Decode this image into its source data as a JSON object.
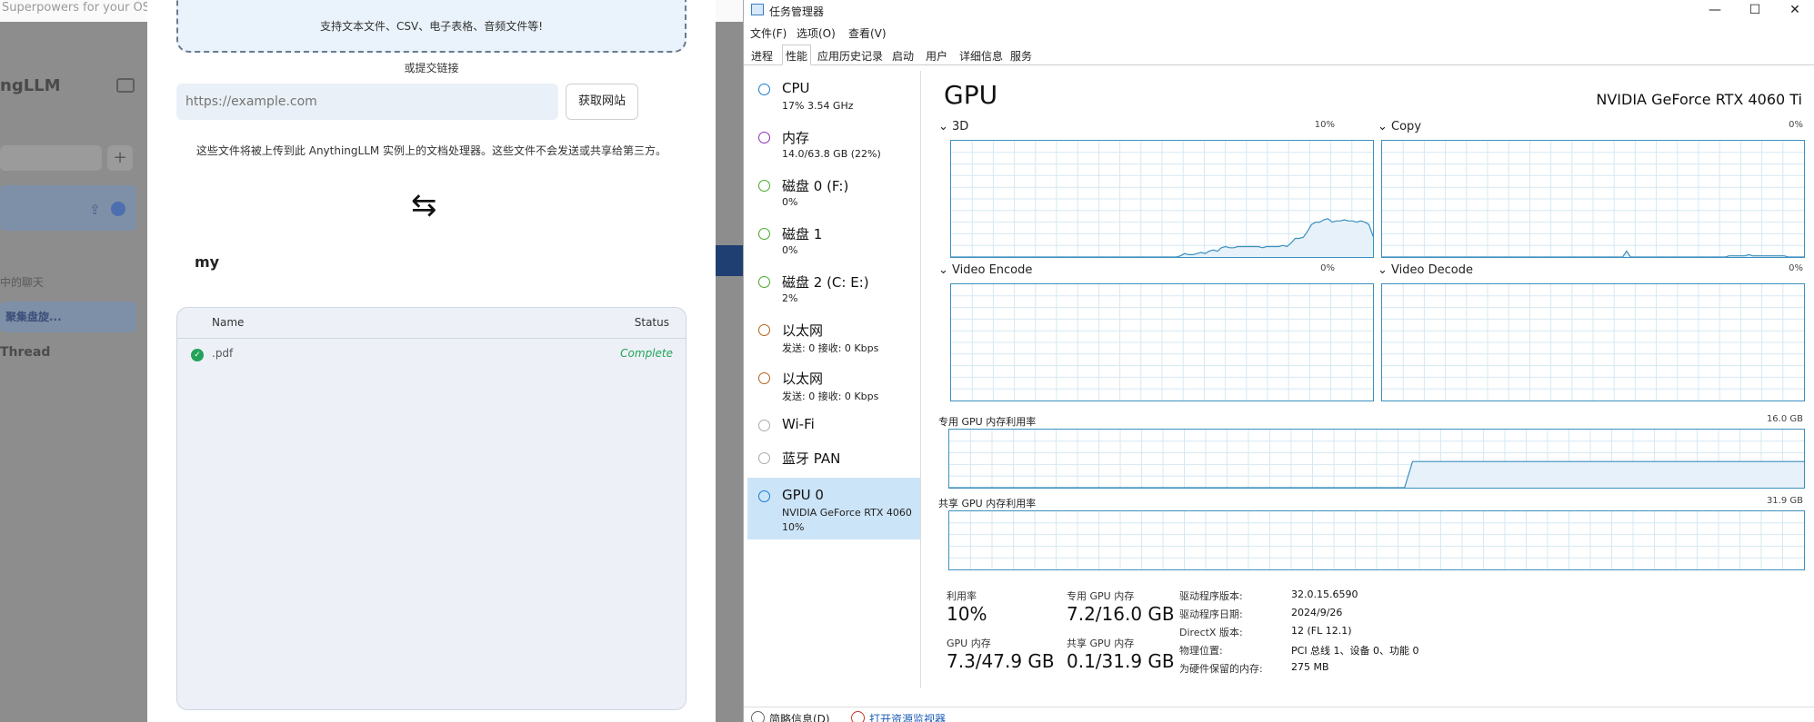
{
  "llm": {
    "tagline": "Superpowers for your OS using local AI",
    "brand": "ngLLM",
    "sidebar_item1": "中的聊天",
    "sidebar_item2": "聚集盘旋...",
    "sidebar_item3": "Thread",
    "modal": {
      "dropzone_text": "支持文本文件、CSV、电子表格、音频文件等!",
      "or_link": "或提交链接",
      "url_placeholder": "https://example.com",
      "fetch_button": "获取网站",
      "notice": "这些文件将被上传到此 AnythingLLM 实例上的文档处理器。这些文件不会发送或共享给第三方。",
      "swap_icon": "⇆",
      "workspace_name": "my",
      "table": {
        "col_name": "Name",
        "col_status": "Status",
        "rows": [
          {
            "name": ".pdf",
            "status": "Complete"
          }
        ]
      }
    }
  },
  "tm": {
    "title": "任务管理器",
    "window_buttons": {
      "minimize": "—",
      "maximize": "☐",
      "close": "✕"
    },
    "menu": [
      "文件(F)",
      "选项(O)",
      "查看(V)"
    ],
    "tabs": [
      "进程",
      "性能",
      "应用历史记录",
      "启动",
      "用户",
      "详细信息",
      "服务"
    ],
    "active_tab": "性能",
    "sidebar": [
      {
        "name": "CPU",
        "sub": "17% 3.54 GHz",
        "sub2": "",
        "color": "#1a7bd3"
      },
      {
        "name": "内存",
        "sub": "14.0/63.8 GB (22%)",
        "sub2": "",
        "color": "#8b2fb8"
      },
      {
        "name": "磁盘 0 (F:)",
        "sub": "0%",
        "sub2": "",
        "color": "#4aa829"
      },
      {
        "name": "磁盘 1",
        "sub": "0%",
        "sub2": "",
        "color": "#4aa829"
      },
      {
        "name": "磁盘 2 (C: E:)",
        "sub": "2%",
        "sub2": "",
        "color": "#4aa829"
      },
      {
        "name": "以太网",
        "sub": "发送: 0 接收: 0 Kbps",
        "sub2": "",
        "color": "#b3621a"
      },
      {
        "name": "以太网",
        "sub": "发送: 0 接收: 0 Kbps",
        "sub2": "",
        "color": "#b3621a"
      },
      {
        "name": "Wi-Fi",
        "sub": "",
        "sub2": "",
        "color": "#aaaaaa"
      },
      {
        "name": "蓝牙 PAN",
        "sub": "",
        "sub2": "",
        "color": "#aaaaaa"
      },
      {
        "name": "GPU 0",
        "sub": "NVIDIA GeForce RTX 4060",
        "sub2": "10%",
        "color": "#1a7bd3"
      }
    ],
    "gpu": {
      "title": "GPU",
      "model": "NVIDIA GeForce RTX 4060 Ti",
      "graphs": {
        "g3d": {
          "label": "3D",
          "pct": "10%"
        },
        "copy": {
          "label": "Copy",
          "pct": "0%"
        },
        "encode": {
          "label": "Video Encode",
          "pct": "0%"
        },
        "decode": {
          "label": "Video Decode",
          "pct": "0%"
        },
        "dedicated": {
          "label": "专用 GPU 内存利用率",
          "max": "16.0 GB"
        },
        "shared": {
          "label": "共享 GPU 内存利用率",
          "max": "31.9 GB"
        }
      },
      "series_3d": [
        0,
        0,
        0,
        0,
        0,
        0,
        0,
        0,
        0,
        0,
        0,
        0,
        0,
        0,
        0,
        0,
        0,
        0,
        0,
        0,
        0,
        0,
        0,
        0,
        0,
        0,
        0,
        0,
        0,
        0,
        0,
        0,
        0,
        0,
        0,
        0,
        0,
        0,
        0,
        0,
        0,
        0,
        0,
        0,
        0,
        0,
        0,
        0,
        0,
        0,
        0,
        0,
        0,
        0,
        0,
        0,
        1,
        3,
        2,
        2,
        3,
        4,
        3,
        5,
        6,
        5,
        8,
        9,
        8,
        8,
        9,
        9,
        9,
        9,
        9,
        9,
        8,
        9,
        9,
        9,
        9,
        10,
        9,
        12,
        16,
        16,
        17,
        22,
        28,
        30,
        30,
        32,
        33,
        30,
        31,
        31,
        32,
        31,
        31,
        30,
        31,
        30,
        28,
        18
      ],
      "series_copy": [
        0,
        0,
        0,
        0,
        0,
        0,
        0,
        0,
        0,
        0,
        0,
        0,
        0,
        0,
        0,
        0,
        0,
        0,
        0,
        0,
        0,
        0,
        0,
        0,
        0,
        0,
        0,
        0,
        0,
        0,
        0,
        0,
        0,
        0,
        0,
        0,
        0,
        0,
        0,
        0,
        0,
        0,
        0,
        0,
        0,
        0,
        0,
        0,
        0,
        0,
        0,
        0,
        0,
        0,
        0,
        0,
        0,
        0,
        0,
        0,
        0,
        0,
        5,
        0,
        0,
        0,
        0,
        0,
        0,
        0,
        0,
        0,
        0,
        0,
        0,
        0,
        0,
        0,
        0,
        0,
        0,
        0,
        0,
        0,
        0,
        0,
        0,
        0,
        1,
        1,
        1,
        1,
        1,
        2,
        1,
        1,
        1,
        1,
        1,
        1,
        1,
        1,
        1,
        0,
        0,
        0,
        0,
        0
      ],
      "series_dedicated": [
        0,
        0,
        0,
        0,
        0,
        0,
        0,
        0,
        0,
        0,
        0,
        0,
        0,
        0,
        0,
        0,
        0,
        0,
        0,
        0,
        0,
        0,
        0,
        0,
        0,
        0,
        0,
        0,
        0,
        0,
        0,
        0,
        0,
        0,
        0,
        0,
        0,
        0,
        0,
        0,
        0,
        0,
        0,
        0,
        0,
        0,
        0,
        0,
        0,
        0,
        0,
        0,
        0,
        0,
        0,
        0,
        0,
        0,
        45,
        45,
        45,
        45,
        45,
        45,
        45,
        45,
        45,
        45,
        45,
        45,
        45,
        45,
        45,
        45,
        45,
        45,
        45,
        45,
        45,
        45,
        45,
        45,
        45,
        45,
        45,
        45,
        45,
        45,
        45,
        45,
        45,
        45,
        45,
        45,
        45,
        45,
        45,
        45,
        45,
        45,
        45,
        45,
        45,
        45,
        45,
        45,
        45,
        45
      ],
      "stats": {
        "util_label": "利用率",
        "util_value": "10%",
        "ded_label": "专用 GPU 内存",
        "ded_value": "7.2/16.0 GB",
        "gpu_mem_label": "GPU 内存",
        "gpu_mem_value": "7.3/47.9 GB",
        "shared_label": "共享 GPU 内存",
        "shared_value": "0.1/31.9 GB"
      },
      "info": [
        {
          "k": "驱动程序版本:",
          "v": "32.0.15.6590"
        },
        {
          "k": "驱动程序日期:",
          "v": "2024/9/26"
        },
        {
          "k": "DirectX 版本:",
          "v": "12 (FL 12.1)"
        },
        {
          "k": "物理位置:",
          "v": "PCI 总线 1、设备 0、功能 0"
        },
        {
          "k": "为硬件保留的内存:",
          "v": "275 MB"
        }
      ]
    },
    "footer": {
      "summary": "简略信息(D)",
      "monitor": "打开资源监视器"
    },
    "colors": {
      "graph_line": "#3c8fbf",
      "graph_fill": "#e6f1f9",
      "grid": "#d6e8f3",
      "active_side": "#cce4f7",
      "link": "#1a5bb5"
    }
  }
}
